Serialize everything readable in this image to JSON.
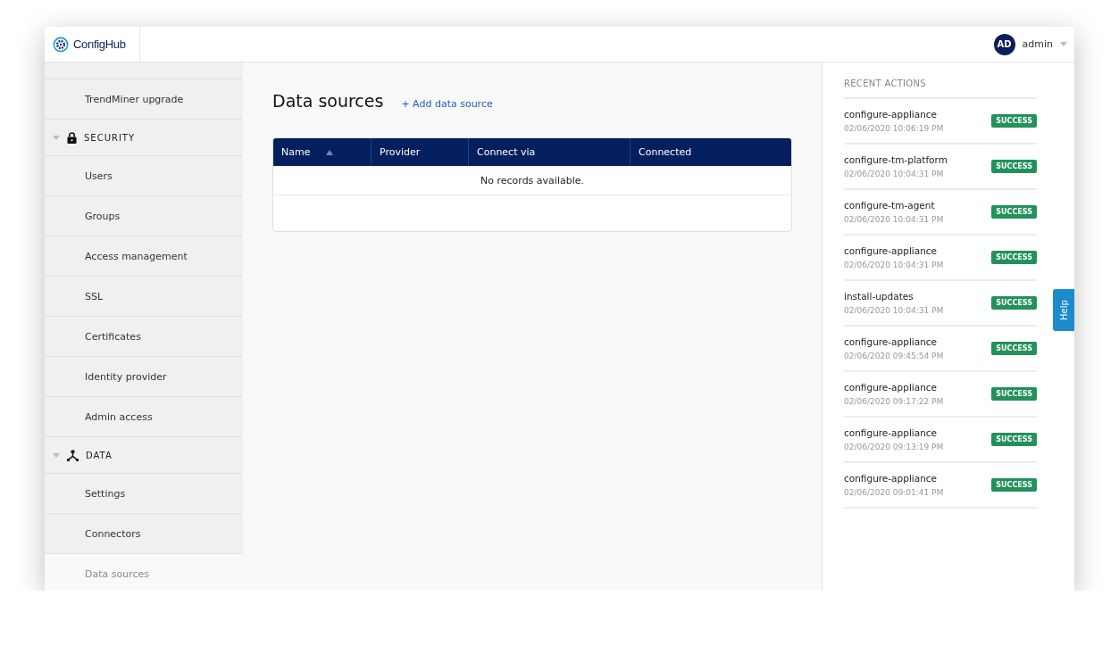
{
  "header": {
    "logo": "ConfigHub",
    "user": {
      "initials": "AD",
      "name": "admin"
    }
  },
  "sidebar": {
    "items": [
      {
        "kind": "item",
        "label": "TrendMiner upgrade",
        "selected": false
      },
      {
        "kind": "section",
        "label": "SECURITY",
        "expanded": true,
        "children": [
          {
            "kind": "item",
            "label": "Users",
            "selected": false
          },
          {
            "kind": "item",
            "label": "Groups",
            "selected": false
          },
          {
            "kind": "item",
            "label": "Access management",
            "selected": false
          },
          {
            "kind": "item",
            "label": "SSL",
            "selected": false
          },
          {
            "kind": "item",
            "label": "Certificates",
            "selected": false
          },
          {
            "kind": "item",
            "label": "Identity provider",
            "selected": false
          },
          {
            "kind": "item",
            "label": "Admin access",
            "selected": false
          }
        ]
      },
      {
        "kind": "section",
        "label": "DATA",
        "expanded": true,
        "children": [
          {
            "kind": "item",
            "label": "Settings",
            "selected": false
          },
          {
            "kind": "item",
            "label": "Connectors",
            "selected": false
          },
          {
            "kind": "item",
            "label": "Data sources",
            "selected": true
          }
        ]
      }
    ]
  },
  "main": {
    "title": "Data sources",
    "add_link": "+ Add data source",
    "table": {
      "columns": [
        {
          "label": "Name",
          "sorted": true
        },
        {
          "label": "Provider"
        },
        {
          "label": "Connect via"
        },
        {
          "label": "Connected"
        }
      ],
      "empty_message": "No records available."
    }
  },
  "recent_actions": {
    "title": "RECENT ACTIONS",
    "items": [
      {
        "name": "configure-appliance",
        "time": "02/06/2020 10:06:19 PM",
        "status": "SUCCESS"
      },
      {
        "name": "configure-tm-platform",
        "time": "02/06/2020 10:04:31 PM",
        "status": "SUCCESS"
      },
      {
        "name": "configure-tm-agent",
        "time": "02/06/2020 10:04:31 PM",
        "status": "SUCCESS"
      },
      {
        "name": "configure-appliance",
        "time": "02/06/2020 10:04:31 PM",
        "status": "SUCCESS"
      },
      {
        "name": "install-updates",
        "time": "02/06/2020 10:04:31 PM",
        "status": "SUCCESS"
      },
      {
        "name": "configure-appliance",
        "time": "02/06/2020 09:45:54 PM",
        "status": "SUCCESS"
      },
      {
        "name": "configure-appliance",
        "time": "02/06/2020 09:17:22 PM",
        "status": "SUCCESS"
      },
      {
        "name": "configure-appliance",
        "time": "02/06/2020 09:13:19 PM",
        "status": "SUCCESS"
      },
      {
        "name": "configure-appliance",
        "time": "02/06/2020 09:01:41 PM",
        "status": "SUCCESS"
      }
    ]
  },
  "help_tab": "Help"
}
